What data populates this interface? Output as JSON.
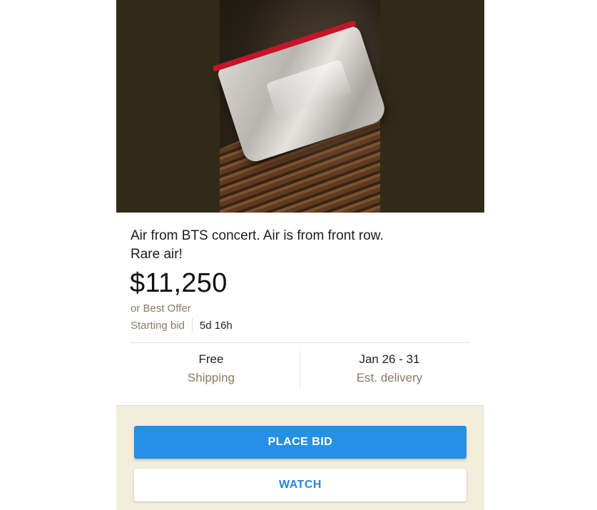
{
  "listing": {
    "title": "Air from BTS concert. Air is from front row. Rare air!",
    "price": "$11,250",
    "best_offer": "or Best Offer",
    "starting_bid_label": "Starting bid",
    "time_left": "5d 16h"
  },
  "shipping": {
    "cost": "Free",
    "label": "Shipping"
  },
  "delivery": {
    "dates": "Jan 26 - 31",
    "label": "Est. delivery"
  },
  "actions": {
    "place_bid": "PLACE BID",
    "watch": "WATCH"
  },
  "colors": {
    "primary_button": "#2590e6",
    "secondary_text": "#8c7a62",
    "footer_bg": "#f2eddc"
  }
}
